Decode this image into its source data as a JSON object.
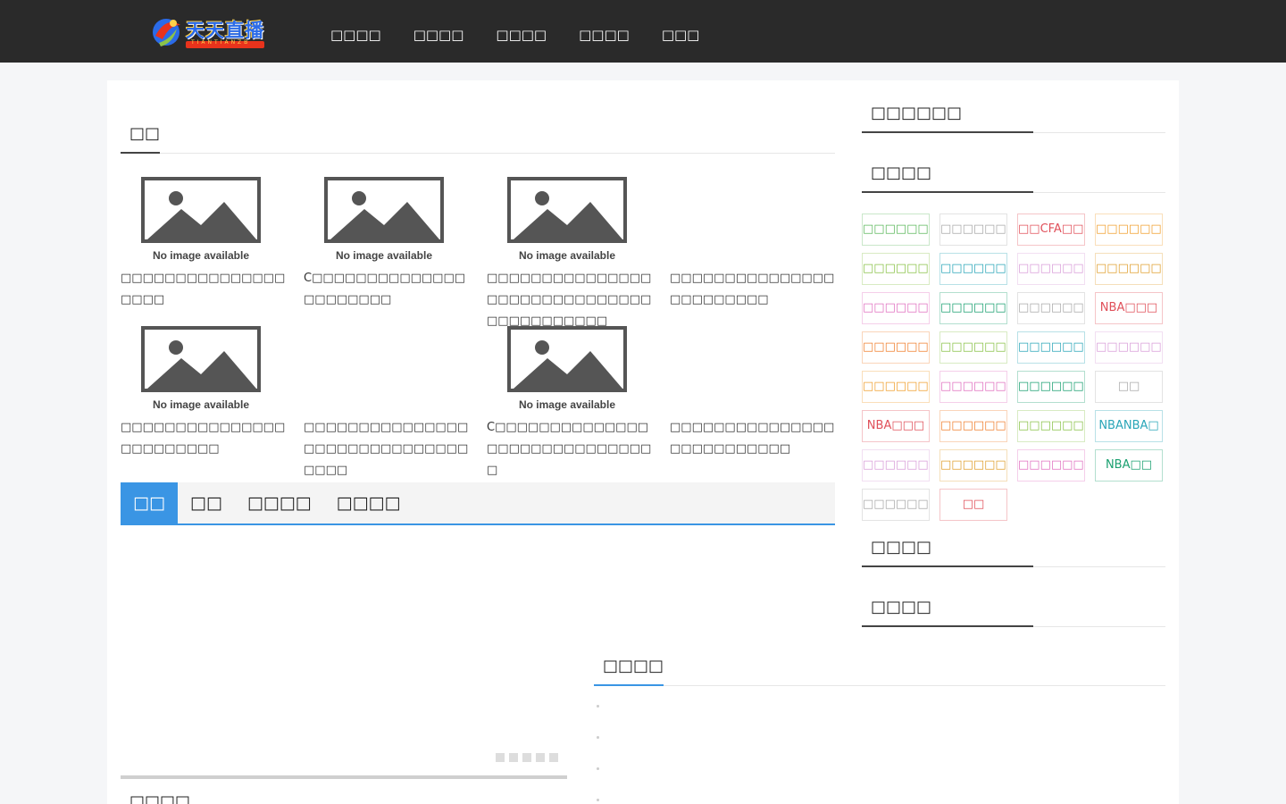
{
  "header": {
    "logo_text": "天天直播",
    "logo_sub": "TIANTIANZB",
    "nav": [
      "□□□□",
      "□□□□",
      "□□□□",
      "□□□□",
      "□□□"
    ]
  },
  "main": {
    "section_title": "□□",
    "no_image_text": "No image available",
    "articles": [
      {
        "title": "□□□□□□□□□□□□□□□□□□□",
        "image": true
      },
      {
        "title": "C□□□□□□□□□□□□□□□□□□□□□□",
        "image": true
      },
      {
        "title": "□□□□□□□□□□□□□□□□□□□□□□□□□□□□□□□□□□□□□□□□□",
        "image": true
      },
      {
        "title": "□□□□□□□□□□□□□□□□□□□□□□□□",
        "image": false
      },
      {
        "title": "□□□□□□□□□□□□□□□□□□□□□□□□",
        "image": true
      },
      {
        "title": "□□□□□□□□□□□□□□□□□□□□□□□□□□□□□□□□□□",
        "image": false
      },
      {
        "title": "C□□□□□□□□□□□□□□□□□□□□□□□□□□□□□□",
        "image": true
      },
      {
        "title": "□□□□□□□□□□□□□□□□□□□□□□□□□□",
        "image": false
      }
    ],
    "tabs": [
      "□□",
      "□□",
      "□□□□",
      "□□□□"
    ],
    "list_title": "□□□□",
    "bottom_title": "□□□□"
  },
  "sidebar": {
    "sections": [
      "□□□□□□",
      "□□□□",
      "□□□□",
      "□□□□"
    ],
    "tags": [
      {
        "text": "□□□□□□□□□",
        "color": "#5cb85c"
      },
      {
        "text": "□□□□□□□□□",
        "color": "#aaaaaa"
      },
      {
        "text": "□□CFA□□□□",
        "color": "#e0505a"
      },
      {
        "text": "□□□□□□□",
        "color": "#f0a030"
      },
      {
        "text": "□□□□□□□□□",
        "color": "#8bc34a"
      },
      {
        "text": "□□□□□□□",
        "color": "#2aa6b8"
      },
      {
        "text": "□□□□□□□□□",
        "color": "#d99ed9"
      },
      {
        "text": "□□□□□□□□□",
        "color": "#e0a030"
      },
      {
        "text": "□□□□□□□□□",
        "color": "#e070c0"
      },
      {
        "text": "□□□□□□□□□",
        "color": "#1aa070"
      },
      {
        "text": "□□□□□□□□□",
        "color": "#aaaaaa"
      },
      {
        "text": "NBA□□□",
        "color": "#e0505a"
      },
      {
        "text": "□□□□□□□□□",
        "color": "#f08030"
      },
      {
        "text": "□□□□□□□",
        "color": "#8bc34a"
      },
      {
        "text": "□□□□□□□□□",
        "color": "#2aa6b8"
      },
      {
        "text": "□□□□□□□□□",
        "color": "#d99ed9"
      },
      {
        "text": "□□□□□□□□□",
        "color": "#f0a030"
      },
      {
        "text": "□□□□□□□□□",
        "color": "#e070c0"
      },
      {
        "text": "□□□□□□□□□",
        "color": "#1aa070"
      },
      {
        "text": "□□",
        "color": "#aaaaaa"
      },
      {
        "text": "NBA□□□",
        "color": "#e0505a"
      },
      {
        "text": "□□□□□□□□□",
        "color": "#f08030"
      },
      {
        "text": "□□□□□□□□□",
        "color": "#8bc34a"
      },
      {
        "text": "NBANBA□",
        "color": "#2aa6b8"
      },
      {
        "text": "□□□□□□□",
        "color": "#d99ed9"
      },
      {
        "text": "□□□□□□□",
        "color": "#e0a030"
      },
      {
        "text": "□□□□□□□□□",
        "color": "#e070c0"
      },
      {
        "text": "NBA□□",
        "color": "#1aa070"
      },
      {
        "text": "□□□□□□□□□",
        "color": "#aaaaaa"
      },
      {
        "text": "□□",
        "color": "#e0505a"
      }
    ]
  }
}
